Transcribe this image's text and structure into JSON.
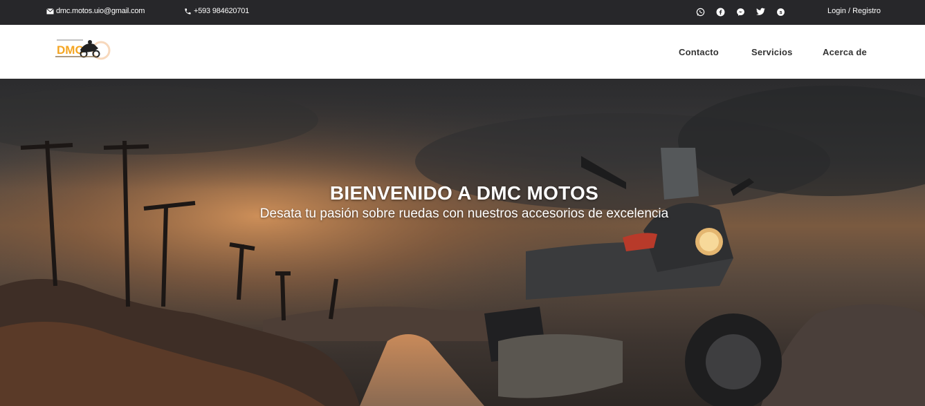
{
  "topbar": {
    "email": "dmc.motos.uio@gmail.com",
    "phone": "+593 984620701",
    "login": "Login / Registro",
    "social_icons": [
      "whatsapp-icon",
      "facebook-icon",
      "messenger-icon",
      "twitter-icon",
      "skype-icon"
    ]
  },
  "header": {
    "logo_text": "DMC",
    "nav": [
      "Contacto",
      "Servicios",
      "Acerca de"
    ]
  },
  "hero": {
    "title": "BIENVENIDO A DMC MOTOS",
    "subtitle": "Desata tu pasión sobre ruedas con nuestros accesorios de excelencia"
  },
  "colors": {
    "topbar_bg": "#27272a",
    "header_bg": "#ffffff",
    "logo_accent": "#f5a623"
  }
}
